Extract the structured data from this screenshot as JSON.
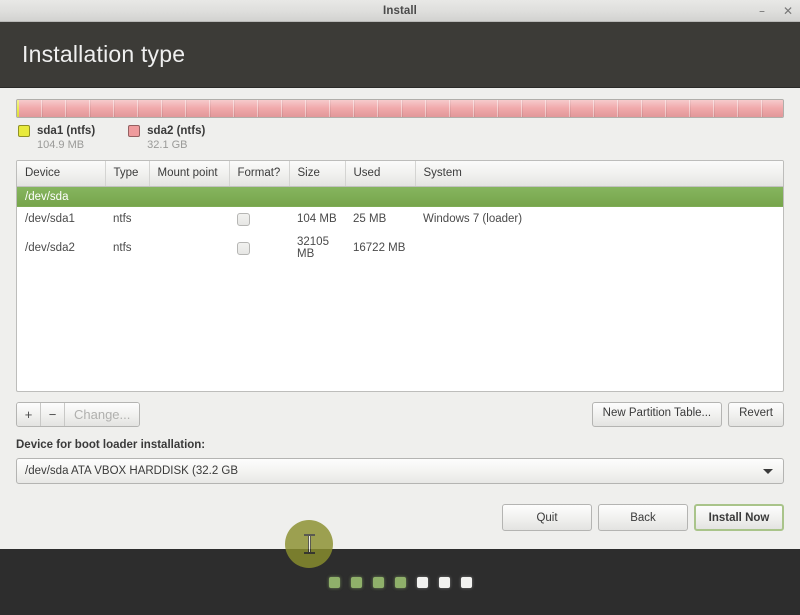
{
  "window": {
    "title": "Install",
    "minimize_label": "–",
    "close_label": "✕"
  },
  "header": {
    "title": "Installation type"
  },
  "partition_bar": {
    "segments": [
      {
        "name": "sda1",
        "color": "#e8ea3c",
        "percent": 0.32
      },
      {
        "name": "sda2",
        "color": "#efa0a2",
        "percent": 99.68
      }
    ]
  },
  "legend": [
    {
      "swatch_color": "#e8ea3c",
      "label": "sda1 (ntfs)",
      "size": "104.9 MB"
    },
    {
      "swatch_color": "#ef9b9d",
      "label": "sda2 (ntfs)",
      "size": "32.1 GB"
    }
  ],
  "table": {
    "columns": [
      "Device",
      "Type",
      "Mount point",
      "Format?",
      "Size",
      "Used",
      "System"
    ],
    "disk_row": {
      "device": "/dev/sda"
    },
    "rows": [
      {
        "device": "/dev/sda1",
        "type": "ntfs",
        "mount_point": "",
        "format": false,
        "size": "104 MB",
        "used": "25 MB",
        "system": "Windows 7 (loader)"
      },
      {
        "device": "/dev/sda2",
        "type": "ntfs",
        "mount_point": "",
        "format": false,
        "size": "32105 MB",
        "used": "16722 MB",
        "system": ""
      }
    ]
  },
  "table_actions": {
    "add_label": "+",
    "remove_label": "−",
    "change_label": "Change...",
    "new_partition_table_label": "New Partition Table...",
    "revert_label": "Revert"
  },
  "boot_loader": {
    "label": "Device for boot loader installation:",
    "selected": "/dev/sda    ATA VBOX HARDDISK (32.2 GB"
  },
  "nav": {
    "quit_label": "Quit",
    "back_label": "Back",
    "install_label": "Install Now"
  },
  "progress_dots": {
    "total": 7,
    "completed": 4,
    "states": [
      "done",
      "done",
      "done",
      "done",
      "todo",
      "todo",
      "todo"
    ]
  }
}
